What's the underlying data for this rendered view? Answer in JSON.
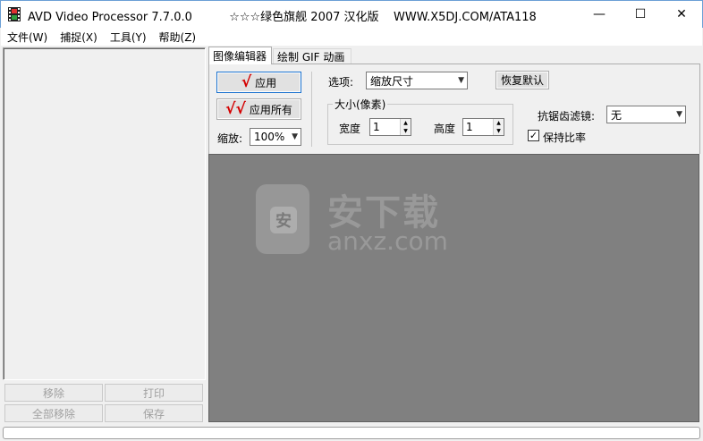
{
  "window": {
    "title": "AVD Video Processor 7.7.0.0          ☆☆☆绿色旗舰 2007 汉化版    WWW.X5DJ.COM/ATA118",
    "min_glyph": "—",
    "max_glyph": "☐",
    "close_glyph": "✕"
  },
  "menu": {
    "items": [
      "文件(W)",
      "捕捉(X)",
      "工具(Y)",
      "帮助(Z)"
    ]
  },
  "left_panel": {
    "remove_label": "移除",
    "print_label": "打印",
    "remove_all_label": "全部移除",
    "save_label": "保存"
  },
  "tabs": {
    "image_editor": "图像编辑器",
    "gif_animation": "绘制 GIF 动画"
  },
  "editor": {
    "apply_label": "应用",
    "apply_all_label": "应用所有",
    "apply_mark": "√",
    "apply_all_mark": "√√",
    "zoom_label": "缩放:",
    "zoom_value": "100%",
    "options_label": "选项:",
    "options_value": "缩放尺寸",
    "restore_label": "恢复默认",
    "size_group_label": "大小(像素)",
    "width_label": "宽度",
    "width_value": "1",
    "height_label": "高度",
    "height_value": "1",
    "antialias_label": "抗锯齿滤镜:",
    "antialias_value": "无",
    "keep_ratio_label": "保持比率",
    "keep_ratio_checked": true
  },
  "watermark": {
    "logo_char": "安",
    "text": "安下载",
    "sub": "anxz.com"
  },
  "colors": {
    "preview_bg": "#808080",
    "accent_border": "#1b72cf",
    "check_red": "#d40000"
  }
}
